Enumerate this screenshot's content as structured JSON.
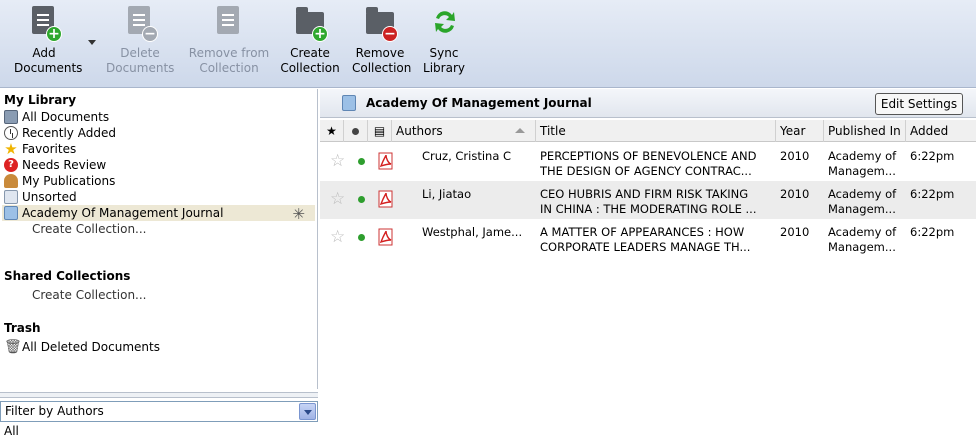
{
  "toolbar": {
    "add_documents": "Add Documents",
    "delete_documents": "Delete Documents",
    "remove_from_collection": "Remove from Collection",
    "create_collection": "Create Collection",
    "remove_collection": "Remove Collection",
    "sync_library": "Sync Library"
  },
  "sidebar": {
    "my_library": "My Library",
    "items": [
      {
        "label": "All Documents",
        "icon": "all-documents-icon"
      },
      {
        "label": "Recently Added",
        "icon": "clock-icon"
      },
      {
        "label": "Favorites",
        "icon": "star-icon"
      },
      {
        "label": "Needs Review",
        "icon": "question-icon"
      },
      {
        "label": "My Publications",
        "icon": "person-icon"
      },
      {
        "label": "Unsorted",
        "icon": "unsorted-icon"
      },
      {
        "label": "Academy Of Management Journal",
        "icon": "collection-icon"
      }
    ],
    "create_collection": "Create Collection...",
    "shared_collections": "Shared Collections",
    "shared_create_collection": "Create Collection...",
    "trash": "Trash",
    "all_deleted": "All Deleted Documents",
    "filter_label": "Filter by Authors",
    "filter_value": "All"
  },
  "main": {
    "collection_title": "Academy Of Management Journal",
    "edit_settings": "Edit Settings",
    "columns": {
      "authors": "Authors",
      "title": "Title",
      "year": "Year",
      "published_in": "Published In",
      "added": "Added"
    },
    "rows": [
      {
        "authors": "Cruz, Cristina C",
        "title1": "PERCEPTIONS OF BENEVOLENCE AND",
        "title2": "THE DESIGN OF AGENCY CONTRAC...",
        "year": "2010",
        "pub1": "Academy of",
        "pub2": "Managem...",
        "added": "6:22pm"
      },
      {
        "authors": "Li, Jiatao",
        "title1": "CEO HUBRIS AND FIRM RISK TAKING",
        "title2": "IN CHINA : THE MODERATING ROLE ...",
        "year": "2010",
        "pub1": "Academy of",
        "pub2": "Managem...",
        "added": "6:22pm"
      },
      {
        "authors": "Westphal, Jame...",
        "title1": "A MATTER OF APPEARANCES : HOW",
        "title2": "CORPORATE LEADERS MANAGE TH...",
        "year": "2010",
        "pub1": "Academy of",
        "pub2": "Managem...",
        "added": "6:22pm"
      }
    ]
  },
  "colors": {
    "toolbar_top": "#e6ecf6",
    "toolbar_bottom": "#cdd8ea",
    "selected_row": "#ede8d5",
    "read_dot": "#2e9e2e",
    "pdf_red": "#d42020"
  }
}
